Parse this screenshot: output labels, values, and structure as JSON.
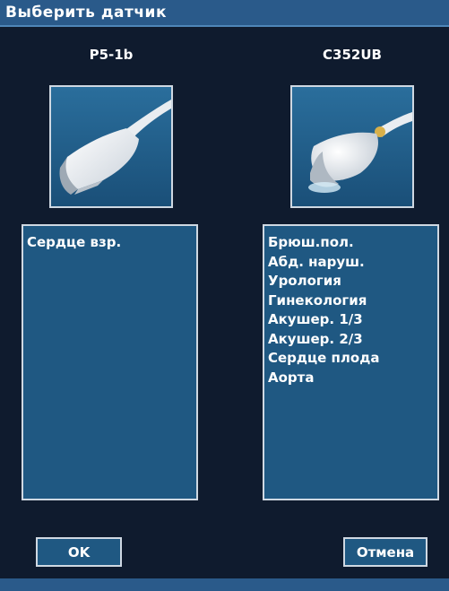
{
  "dialog": {
    "title": "Выберить датчик",
    "colors": {
      "background": "#0f1b2e",
      "panel": "#1f5882",
      "titlebar": "#2a5a8a",
      "border": "#cfd8e2"
    }
  },
  "probes": [
    {
      "name": "P5-1b",
      "image_icon": "phased-array-probe-icon",
      "applications": [
        "Сердце взр."
      ]
    },
    {
      "name": "C352UB",
      "image_icon": "convex-probe-icon",
      "applications": [
        "Брюш.пол.",
        "Абд. наруш.",
        "Урология",
        "Гинекология",
        "Акушер. 1/3",
        "Акушер. 2/3",
        "Сердце плода",
        "Аорта"
      ]
    }
  ],
  "buttons": {
    "ok_label": "OK",
    "cancel_label": "Отмена"
  }
}
